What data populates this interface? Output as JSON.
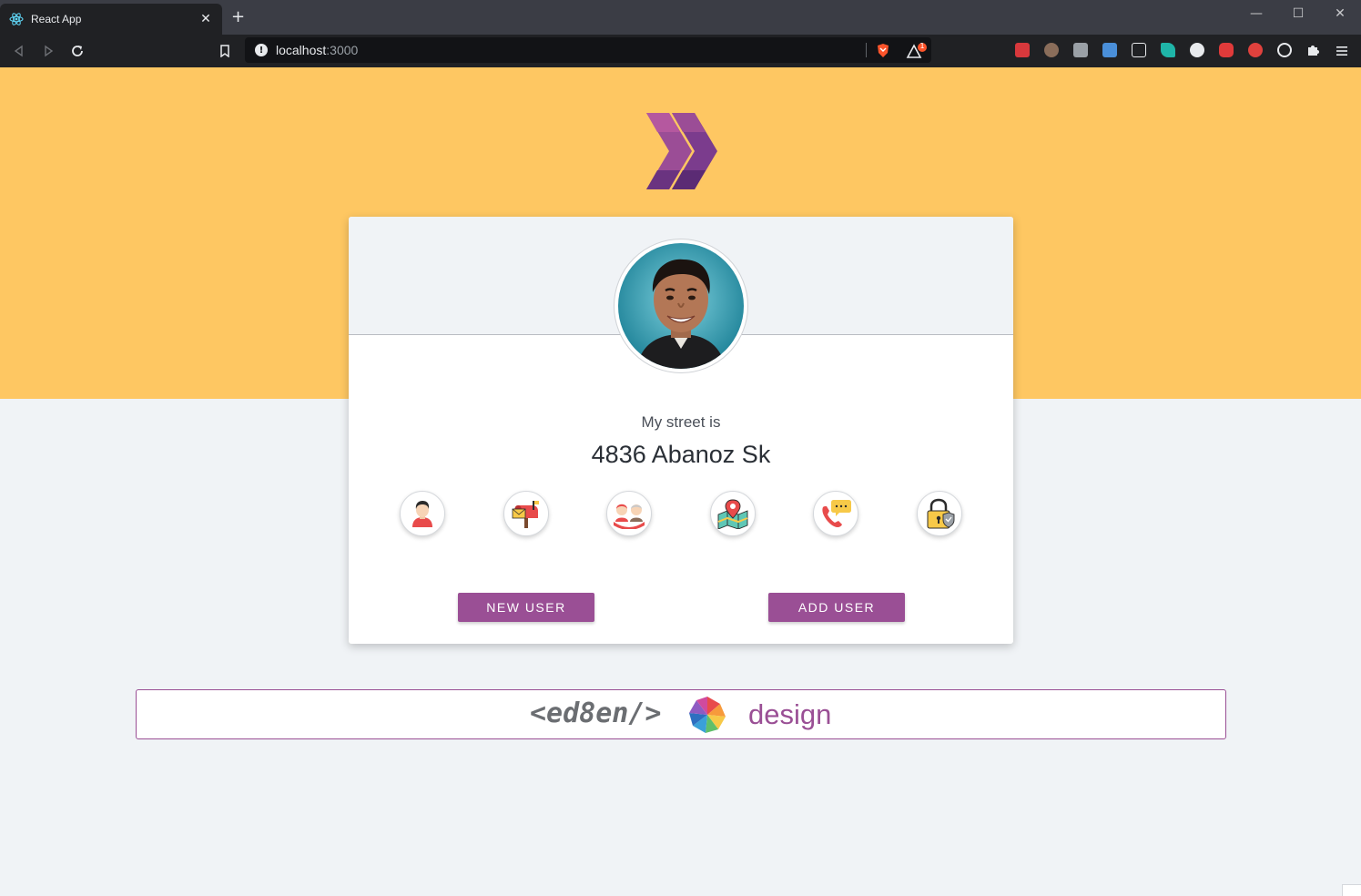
{
  "browser": {
    "tab_title": "React App",
    "tab_close": "✕",
    "new_tab": "+",
    "url_host": "localhost",
    "url_port": ":3000",
    "info_glyph": "!",
    "window_controls": {
      "minimize": "—",
      "maximize": "☐",
      "close": "✕"
    },
    "brave_badge": "1"
  },
  "card": {
    "label": "My street is",
    "value": "4836 Abanoz Sk",
    "icons": [
      {
        "name": "user-icon",
        "target": "name"
      },
      {
        "name": "mailbox-icon",
        "target": "email"
      },
      {
        "name": "family-icon",
        "target": "age"
      },
      {
        "name": "map-pin-icon",
        "target": "street"
      },
      {
        "name": "phone-icon",
        "target": "phone"
      },
      {
        "name": "padlock-icon",
        "target": "password"
      }
    ],
    "new_user_label": "NEW USER",
    "add_user_label": "ADD USER"
  },
  "footer": {
    "code_text": "<ed8en/>",
    "design_text": "design"
  },
  "colors": {
    "banner": "#fec762",
    "accent": "#9a4f95",
    "page_bg": "#f0f3f6"
  }
}
